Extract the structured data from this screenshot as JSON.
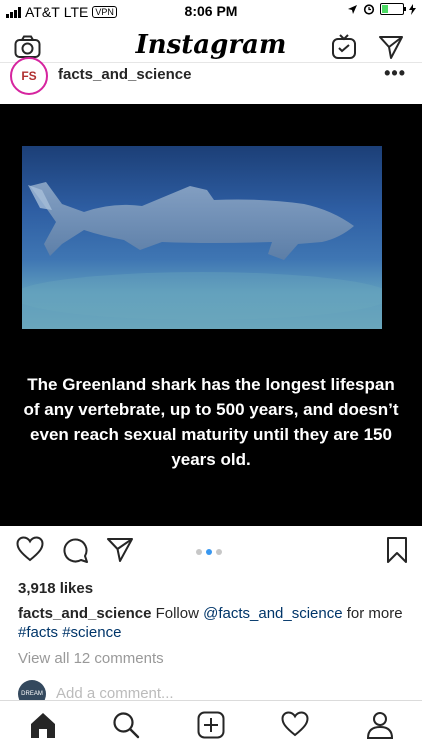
{
  "status_bar": {
    "carrier": "AT&T",
    "network": "LTE",
    "vpn": "VPN",
    "time": "8:06 PM"
  },
  "top_nav": {
    "logo": "Instagram",
    "icons": [
      "camera-icon",
      "igtv-icon",
      "direct-message-icon"
    ]
  },
  "post": {
    "avatar_text": "FS",
    "username": "facts_and_science",
    "more": "•••",
    "image_text": "The Greenland shark has the longest lifespan of any vertebrate, up to 500 years, and doesn’t even reach sexual maturity until they are 150 years old.",
    "carousel_total": 3,
    "carousel_active": 2,
    "likes": "3,918 likes",
    "caption_user": "facts_and_science",
    "caption_text_1": " Follow ",
    "caption_mention": "@facts_and_science",
    "caption_text_2": " for more ",
    "caption_tag_1": "#facts",
    "caption_space": " ",
    "caption_tag_2": "#science",
    "view_comments": "View all 12 comments",
    "add_comment_placeholder": "Add a comment...",
    "commenter_avatar_text": "DREAM BIG"
  },
  "tab_bar": {
    "icons": [
      "home-icon",
      "search-icon",
      "new-post-icon",
      "activity-icon",
      "profile-icon"
    ]
  },
  "colors": {
    "link": "#003569",
    "carousel_active": "#3897f0",
    "avatar_ring": "#d6249f"
  }
}
